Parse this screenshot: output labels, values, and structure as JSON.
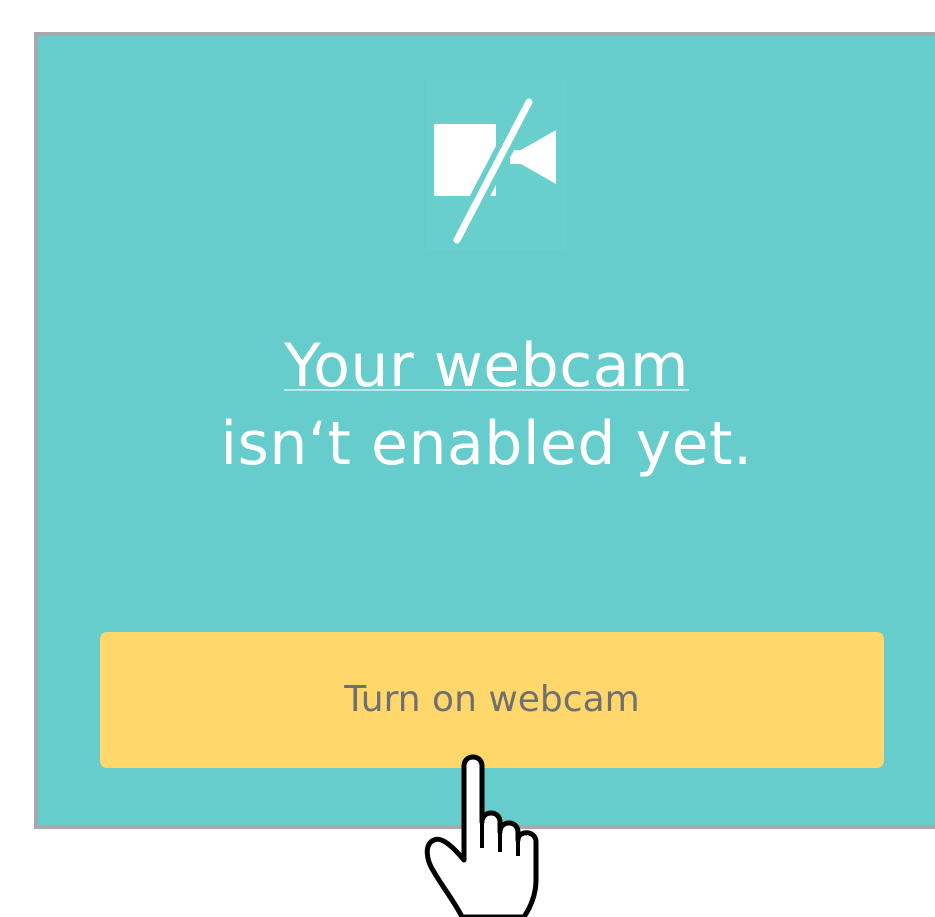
{
  "colors": {
    "panel_background": "#66cccc",
    "panel_border": "#a7a9ac",
    "button_background": "#ffd76a",
    "button_text": "#707070",
    "message_text": "#ffffff"
  },
  "icons": {
    "status": "webcam-off-icon",
    "pointer": "hand-pointer-cursor"
  },
  "message": {
    "line1": "Your webcam",
    "line2": "isn‘t enabled yet."
  },
  "button": {
    "label": "Turn on webcam"
  }
}
